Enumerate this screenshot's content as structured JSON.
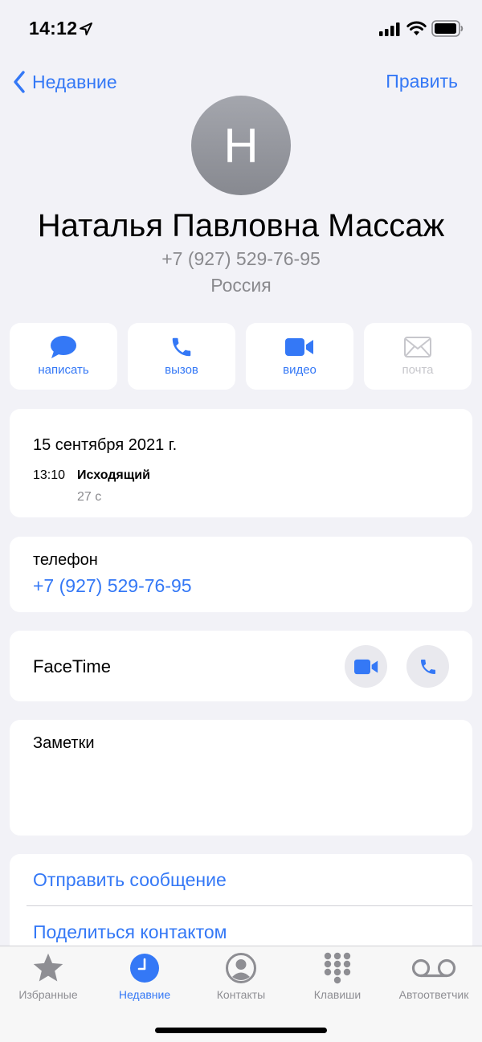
{
  "status_bar": {
    "time": "14:12"
  },
  "nav": {
    "back_label": "Недавние",
    "edit_label": "Править"
  },
  "contact": {
    "initial": "Н",
    "name": "Наталья Павловна Массаж",
    "phone": "+7 (927) 529-76-95",
    "country": "Россия"
  },
  "actions": [
    {
      "label": "написать",
      "icon": "message-bubble-icon",
      "enabled": true
    },
    {
      "label": "вызов",
      "icon": "phone-icon",
      "enabled": true
    },
    {
      "label": "видео",
      "icon": "video-camera-icon",
      "enabled": true
    },
    {
      "label": "почта",
      "icon": "envelope-icon",
      "enabled": false
    }
  ],
  "recent_call": {
    "date": "15 сентября 2021 г.",
    "time": "13:10",
    "type": "Исходящий",
    "duration": "27 с"
  },
  "phone_field": {
    "label": "телефон",
    "value": "+7 (927) 529-76-95"
  },
  "facetime": {
    "label": "FaceTime"
  },
  "notes": {
    "label": "Заметки"
  },
  "links": {
    "send_message": "Отправить сообщение",
    "share_contact": "Поделиться контактом"
  },
  "tabs": [
    {
      "label": "Избранные",
      "icon": "star-icon",
      "active": false
    },
    {
      "label": "Недавние",
      "icon": "clock-icon",
      "active": true
    },
    {
      "label": "Контакты",
      "icon": "person-circle-icon",
      "active": false
    },
    {
      "label": "Клавиши",
      "icon": "keypad-icon",
      "active": false
    },
    {
      "label": "Автоответчик",
      "icon": "voicemail-icon",
      "active": false
    }
  ],
  "colors": {
    "accent": "#3478f6",
    "background": "#f2f2f7",
    "secondary_text": "#8a8a8e",
    "disabled": "#c7c7cc"
  }
}
